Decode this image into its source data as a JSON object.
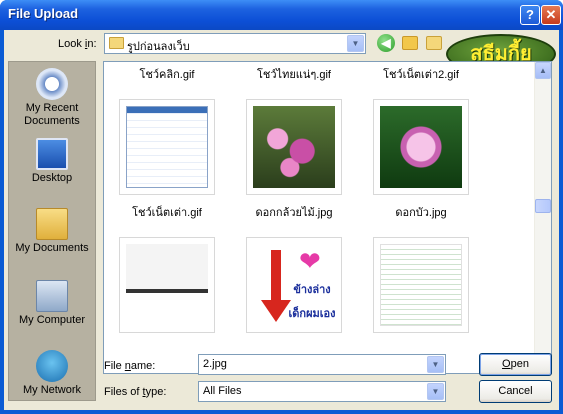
{
  "window": {
    "title": "File Upload",
    "help_glyph": "?",
    "close_glyph": "✕"
  },
  "toolbar": {
    "look_in_label": "Look in:",
    "look_in_value": "รูปก่อนลงเว็บ",
    "back_glyph": "◀",
    "watermark_text": "สธีมกี้ย"
  },
  "places": [
    {
      "label": "My Recent Documents",
      "icon": "recent-documents-icon"
    },
    {
      "label": "Desktop",
      "icon": "desktop-icon"
    },
    {
      "label": "My Documents",
      "icon": "my-documents-icon"
    },
    {
      "label": "My Computer",
      "icon": "my-computer-icon"
    },
    {
      "label": "My Network",
      "icon": "my-network-icon"
    }
  ],
  "files": {
    "top_row": [
      "โชว์คลิก.gif",
      "โชว์ไทยแน่ๆ.gif",
      "โชว์เน็ตเต่า2.gif"
    ],
    "items": [
      {
        "name": "โชว์เน็ตเต่า.gif"
      },
      {
        "name": "ดอกกล้วยไม้.jpg"
      },
      {
        "name": "ดอกบัว.jpg"
      }
    ],
    "arrow_image_text": [
      "ข้างล่าง",
      "เด็กผมเอง"
    ],
    "heart_glyph": "❤"
  },
  "form": {
    "file_name_label": "File name:",
    "file_name_value": "2.jpg",
    "files_of_type_label": "Files of type:",
    "files_of_type_value": "All Files",
    "open_button": "Open",
    "cancel_button": "Cancel"
  },
  "glyphs": {
    "down": "▼",
    "up": "▲"
  }
}
